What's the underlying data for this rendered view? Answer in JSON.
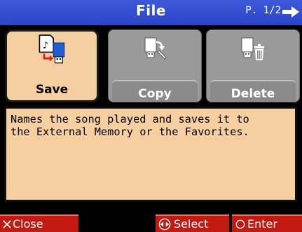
{
  "header": {
    "title": "File",
    "page": "P. 1/2"
  },
  "tiles": [
    {
      "label": "Save",
      "icon": "save-to-usb-icon",
      "selected": true
    },
    {
      "label": "Copy",
      "icon": "copy-file-icon",
      "selected": false
    },
    {
      "label": "Delete",
      "icon": "delete-file-icon",
      "selected": false
    }
  ],
  "description": "Names the song played and saves it to\nthe External Memory or the Favorites.",
  "footer": {
    "close_label": "Close",
    "select_label": "Select",
    "enter_label": "Enter"
  },
  "colors": {
    "header_bg": "#2f4bd0",
    "selected_bg": "#f5cfa0",
    "inactive_bg": "#9a9a9a",
    "footer_bg": "#c21a10"
  }
}
